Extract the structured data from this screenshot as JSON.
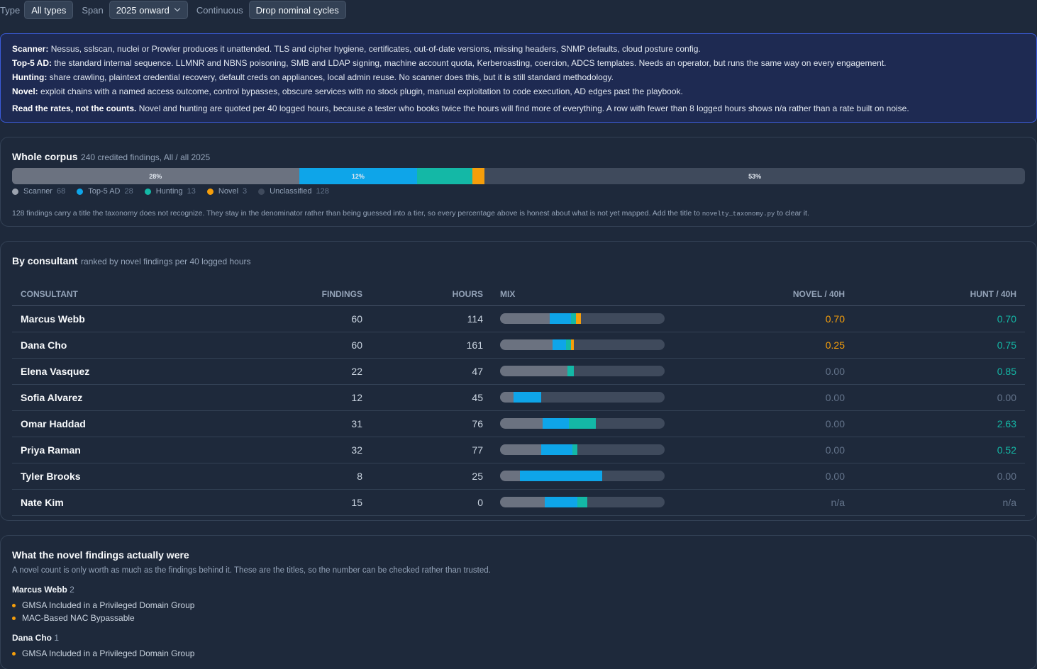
{
  "toolbar": {
    "type_label": "Type",
    "type_value": "All types",
    "span_label": "Span",
    "span_value": "2025 onward",
    "continuous_label": "Continuous",
    "drop_button": "Drop nominal cycles"
  },
  "info": {
    "lines": [
      {
        "term": "Scanner:",
        "text": " Nessus, sslscan, nuclei or Prowler produces it unattended. TLS and cipher hygiene, certificates, out-of-date versions, missing headers, SNMP defaults, cloud posture config."
      },
      {
        "term": "Top-5 AD:",
        "text": " the standard internal sequence. LLMNR and NBNS poisoning, SMB and LDAP signing, machine account quota, Kerberoasting, coercion, ADCS templates. Needs an operator, but runs the same way on every engagement."
      },
      {
        "term": "Hunting:",
        "text": " share crawling, plaintext credential recovery, default creds on appliances, local admin reuse. No scanner does this, but it is still standard methodology."
      },
      {
        "term": "Novel:",
        "text": " exploit chains with a named access outcome, control bypasses, obscure services with no stock plugin, manual exploitation to code execution, AD edges past the playbook."
      },
      {
        "term": "Read the rates, not the counts.",
        "text": " Novel and hunting are quoted per 40 logged hours, because a tester who books twice the hours will find more of everything. A row with fewer than 8 logged hours shows n/a rather than a rate built on noise."
      }
    ]
  },
  "corpus": {
    "title": "Whole corpus",
    "subtitle": "240 credited findings, All / all 2025",
    "segments": [
      {
        "name": "Scanner",
        "count": 68,
        "color": "#6b7280",
        "label": "28%"
      },
      {
        "name": "Top-5 AD",
        "count": 28,
        "color": "#0ea5e9",
        "label": "12%"
      },
      {
        "name": "Hunting",
        "count": 13,
        "color": "#14b8a6",
        "label": ""
      },
      {
        "name": "Novel",
        "count": 3,
        "color": "#f59e0b",
        "label": ""
      },
      {
        "name": "Unclassified",
        "count": 128,
        "color": "#3f4a5c",
        "label": "53%"
      }
    ],
    "legend_counts": [
      "68",
      "28",
      "13",
      "3",
      "128"
    ],
    "note_before": "128 findings carry a title the taxonomy does not recognize. They stay in the denominator rather than being guessed into a tier, so every percentage above is honest about what is not yet mapped. Add the title to ",
    "note_code": "novelty_taxonomy.py",
    "note_after": " to clear it."
  },
  "consultants": {
    "title": "By consultant",
    "subtitle": "ranked by novel findings per 40 logged hours",
    "columns": [
      "CONSULTANT",
      "FINDINGS",
      "HOURS",
      "MIX",
      "NOVEL / 40H",
      "HUNT / 40H"
    ],
    "rows": [
      {
        "name": "Marcus Webb",
        "findings": "60",
        "hours": "114",
        "novel": "0.70",
        "hunt": "0.70",
        "mix": [
          0.3,
          0.13,
          0.03,
          0.03
        ]
      },
      {
        "name": "Dana Cho",
        "findings": "60",
        "hours": "161",
        "novel": "0.25",
        "hunt": "0.75",
        "mix": [
          0.32,
          0.08,
          0.03,
          0.02
        ]
      },
      {
        "name": "Elena Vasquez",
        "findings": "22",
        "hours": "47",
        "novel": "0.00",
        "hunt": "0.85",
        "mix": [
          0.41,
          0.0,
          0.04,
          0.0
        ]
      },
      {
        "name": "Sofia Alvarez",
        "findings": "12",
        "hours": "45",
        "novel": "0.00",
        "hunt": "0.00",
        "mix": [
          0.08,
          0.17,
          0.0,
          0.0
        ]
      },
      {
        "name": "Omar Haddad",
        "findings": "31",
        "hours": "76",
        "novel": "0.00",
        "hunt": "2.63",
        "mix": [
          0.26,
          0.16,
          0.16,
          0.0
        ]
      },
      {
        "name": "Priya Raman",
        "findings": "32",
        "hours": "77",
        "novel": "0.00",
        "hunt": "0.52",
        "mix": [
          0.25,
          0.19,
          0.03,
          0.0
        ]
      },
      {
        "name": "Tyler Brooks",
        "findings": "8",
        "hours": "25",
        "novel": "0.00",
        "hunt": "0.00",
        "mix": [
          0.12,
          0.5,
          0.0,
          0.0
        ]
      },
      {
        "name": "Nate Kim",
        "findings": "15",
        "hours": "0",
        "novel": "n/a",
        "hunt": "n/a",
        "mix": [
          0.27,
          0.2,
          0.06,
          0.0
        ]
      }
    ]
  },
  "novel": {
    "title": "What the novel findings actually were",
    "note": "A novel count is only worth as much as the findings behind it. These are the titles, so the number can be checked rather than trusted.",
    "groups": [
      {
        "name": "Marcus Webb",
        "count": "2",
        "items": [
          "GMSA Included in a Privileged Domain Group",
          "MAC-Based NAC Bypassable"
        ]
      },
      {
        "name": "Dana Cho",
        "count": "1",
        "items": [
          "GMSA Included in a Privileged Domain Group"
        ]
      }
    ]
  },
  "colors": {
    "scanner": "#6b7280",
    "top5ad": "#0ea5e9",
    "hunting": "#14b8a6",
    "novel": "#f59e0b",
    "unclassified": "#3f4a5c",
    "info_border": "#3b5bdb"
  }
}
